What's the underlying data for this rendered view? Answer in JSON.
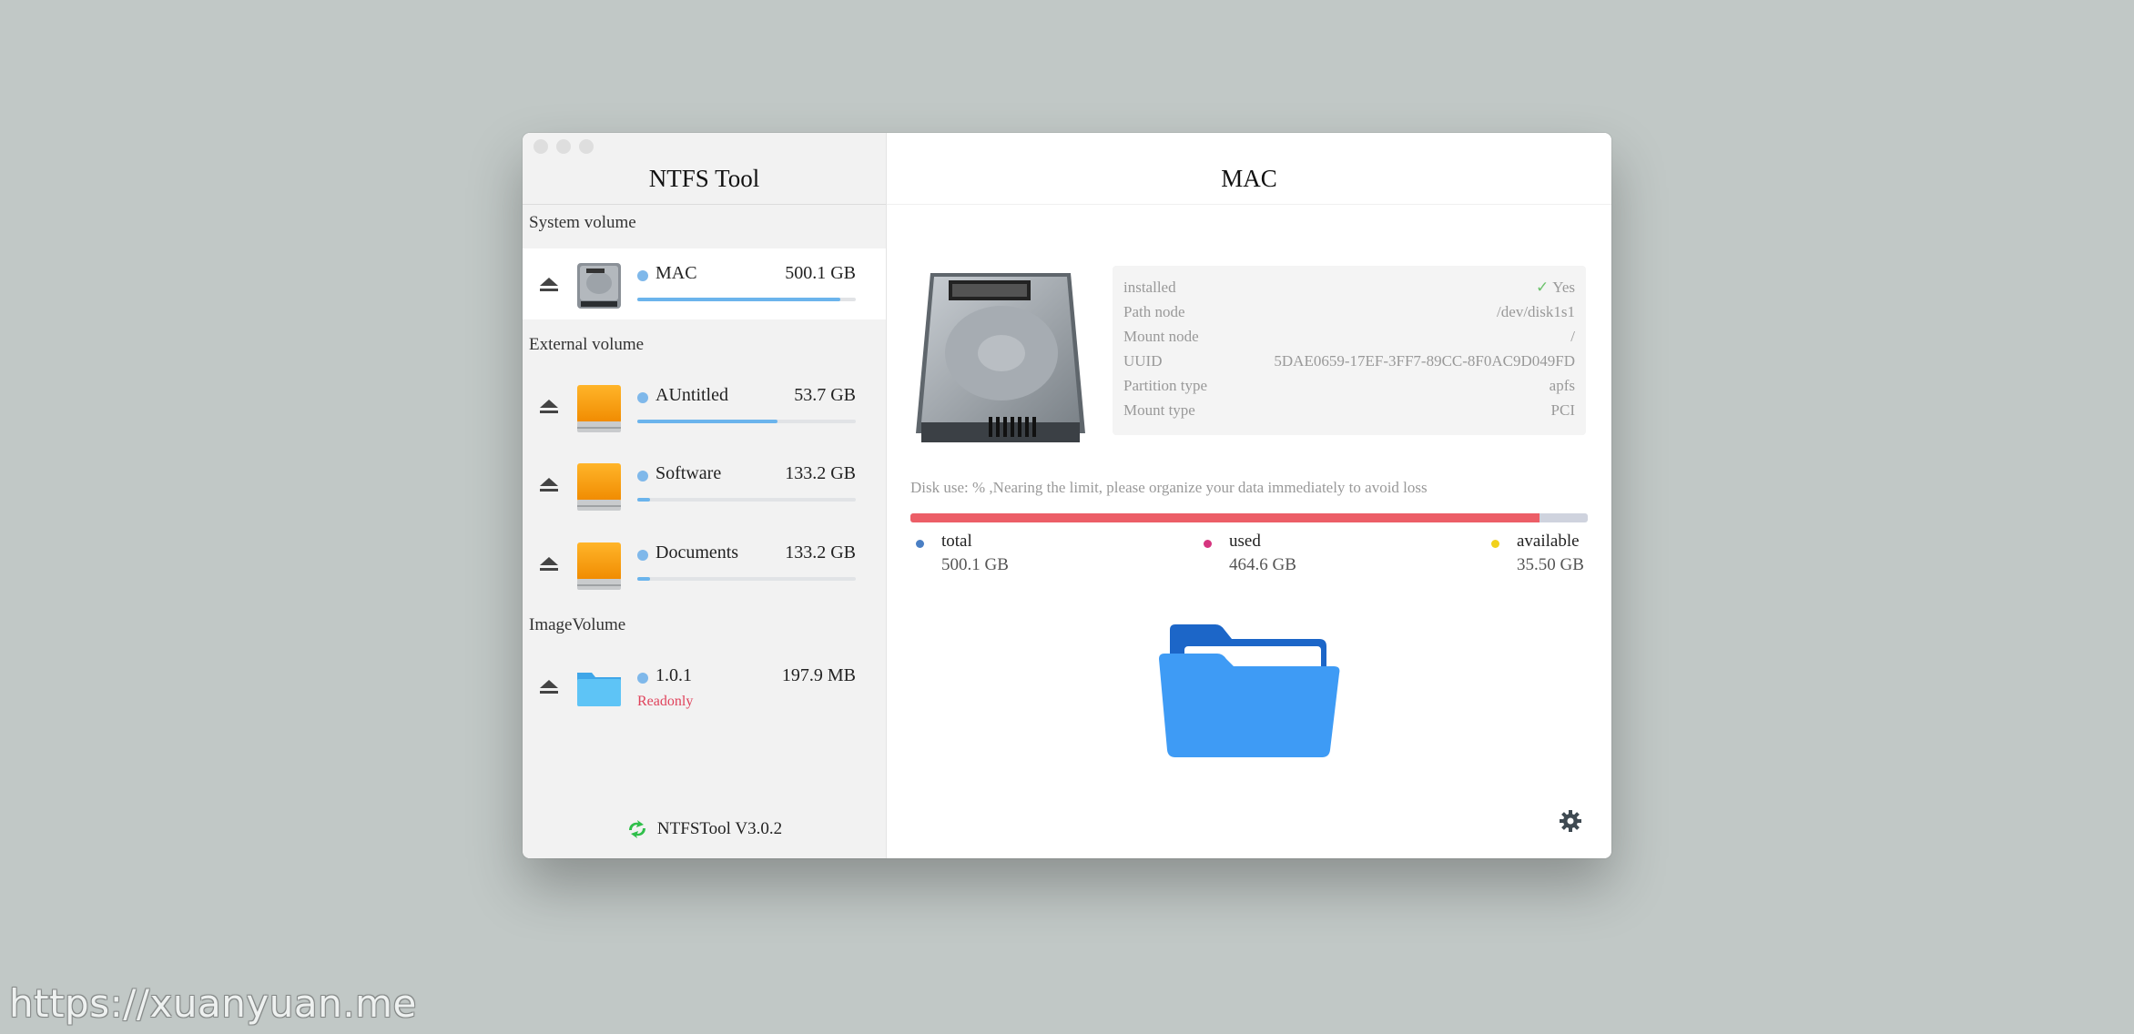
{
  "window": {
    "sidebar_title": "NTFS Tool",
    "main_title": "MAC"
  },
  "sidebar": {
    "sections": {
      "system": "System volume",
      "external": "External volume",
      "image": "ImageVolume"
    },
    "volumes": [
      {
        "name": "MAC",
        "size": "500.1 GB",
        "usage": 0.93,
        "icon": "internal-hdd-icon",
        "selected": true
      },
      {
        "name": "AUntitled",
        "size": "53.7 GB",
        "usage": 0.64,
        "icon": "external-drive-icon"
      },
      {
        "name": "Software",
        "size": "133.2 GB",
        "usage": 0.06,
        "icon": "external-drive-icon"
      },
      {
        "name": "Documents",
        "size": "133.2 GB",
        "usage": 0.06,
        "icon": "external-drive-icon"
      },
      {
        "name": "1.0.1",
        "size": "197.9 MB",
        "status": "Readonly",
        "icon": "folder-icon"
      }
    ],
    "footer": "NTFSTool V3.0.2"
  },
  "info": {
    "installed": {
      "label": "installed",
      "value": "Yes"
    },
    "path_node": {
      "label": "Path node",
      "value": "/dev/disk1s1"
    },
    "mount_node": {
      "label": "Mount node",
      "value": "/"
    },
    "uuid": {
      "label": "UUID",
      "value": "5DAE0659-17EF-3FF7-89CC-8F0AC9D049FD"
    },
    "partition_type": {
      "label": "Partition type",
      "value": "apfs"
    },
    "mount_type": {
      "label": "Mount type",
      "value": "PCI"
    }
  },
  "disk": {
    "note": "Disk use: % ,Nearing the limit, please organize your data immediately to avoid loss",
    "usage": 0.929,
    "total": {
      "label": "total",
      "value": "500.1 GB",
      "color": "#4a7fc4"
    },
    "used": {
      "label": "used",
      "value": "464.6 GB",
      "color": "#d6357f"
    },
    "available": {
      "label": "available",
      "value": "35.50 GB",
      "color": "#f1d11c"
    }
  },
  "watermark": "https://xuanyuan.me",
  "colors": {
    "accent": "#6bb4ec",
    "danger": "#ec5e67",
    "readonly": "#e0425b"
  }
}
